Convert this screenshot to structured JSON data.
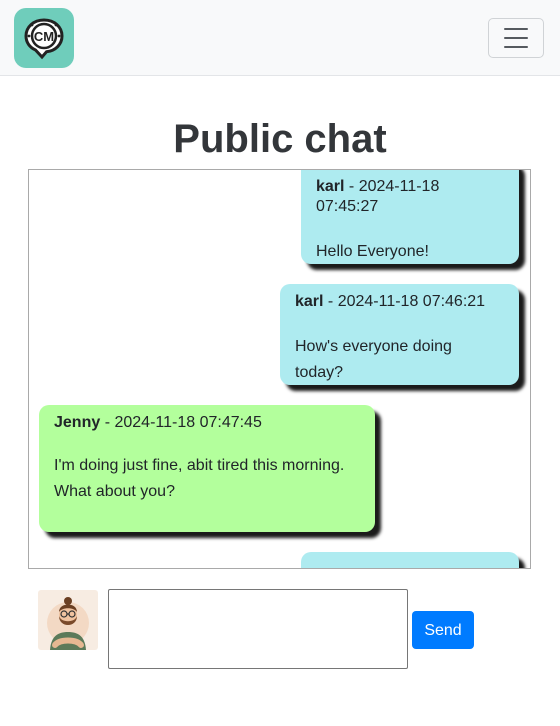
{
  "header": {
    "logo_text": "CM",
    "logo_icon": "chat-bubble-logo",
    "menu_icon": "hamburger-icon"
  },
  "page": {
    "title": "Public chat"
  },
  "messages": [
    {
      "author": "karl",
      "separator": " - ",
      "timestamp": "2024-11-18 07:45:27",
      "text": "Hello Everyone!",
      "own": true
    },
    {
      "author": "karl",
      "separator": " - ",
      "timestamp": "2024-11-18 07:46:21",
      "text": "How's everyone doing today?",
      "own": true
    },
    {
      "author": "Jenny",
      "separator": " - ",
      "timestamp": "2024-11-18 07:47:45",
      "text": "I'm doing just fine, abit tired this morning. What about you?",
      "own": false
    },
    {
      "own": true
    }
  ],
  "composer": {
    "avatar_icon": "user-avatar",
    "input_value": "",
    "send_label": "Send"
  },
  "colors": {
    "own_bubble": "#aeebf0",
    "other_bubble": "#b3ff9c",
    "send_button": "#007bff",
    "logo_bg": "#6fcdbb"
  }
}
